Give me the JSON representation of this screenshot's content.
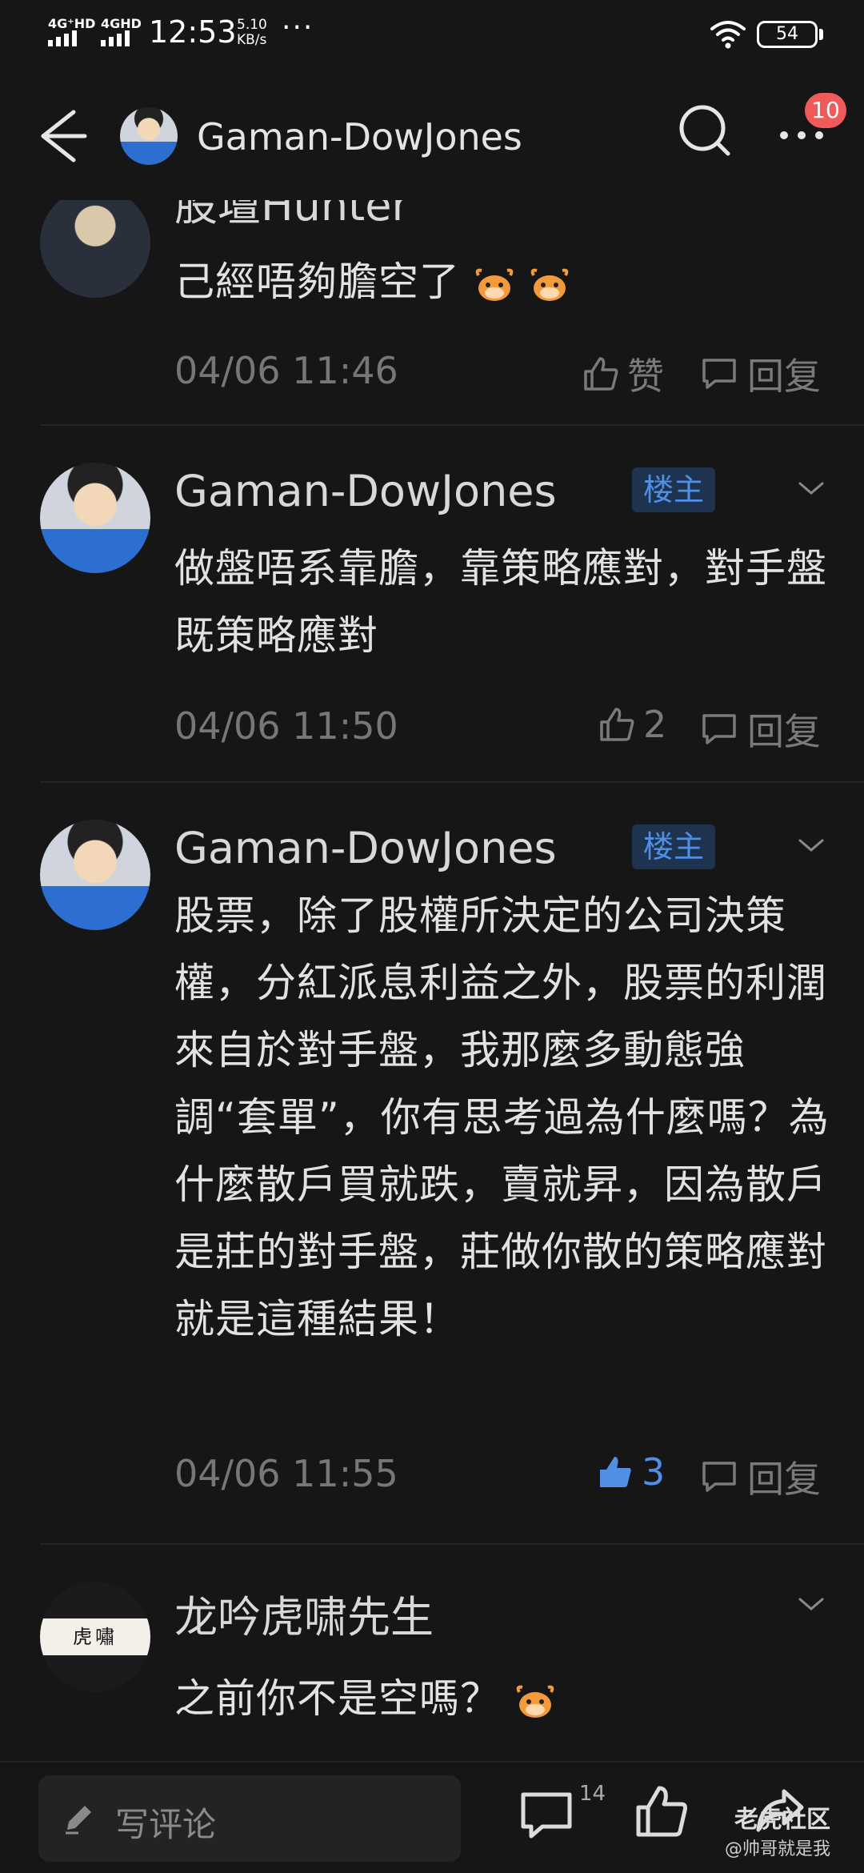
{
  "status_bar": {
    "network1": "4G⁺HD",
    "network2": "4GHD",
    "time": "12:53",
    "speed_value": "5.10",
    "speed_unit": "KB/s",
    "dots": "···",
    "battery": "54"
  },
  "header": {
    "title": "Gaman-DowJones",
    "notification_count": "10"
  },
  "comments": [
    {
      "author": "股壇Hunter",
      "text": "己經唔夠膽空了",
      "time": "04/06 11:46",
      "like_label": "赞",
      "reply_label": "回复"
    },
    {
      "author": "Gaman-DowJones",
      "badge": "楼主",
      "text": "做盤唔系靠膽，靠策略應對，對手盤既策略應對",
      "time": "04/06 11:50",
      "like_label": "2",
      "reply_label": "回复"
    },
    {
      "author": "Gaman-DowJones",
      "badge": "楼主",
      "text": "股票，除了股權所決定的公司決策權，分紅派息利益之外，股票的利潤來自於對手盤，我那麼多動態強調“套單”，你有思考過為什麼嗎？為什麼散戶買就跌，賣就昇，因為散戶是莊的對手盤，莊做你散的策略應對就是這種結果！",
      "time": "04/06 11:55",
      "like_label": "3",
      "reply_label": "回复"
    },
    {
      "author": "龙吟虎啸先生",
      "text": "之前你不是空嗎？",
      "avatar_text": "虎嘯"
    }
  ],
  "bottom_bar": {
    "input_placeholder": "写评论",
    "comment_count": "14",
    "watermark_main": "老虎社区",
    "watermark_sub": "@帅哥就是我"
  },
  "colors": {
    "background": "#161616",
    "accent_blue": "#4f8fe6",
    "badge_bg": "#1e3350",
    "notification_red": "#f05a5a"
  }
}
